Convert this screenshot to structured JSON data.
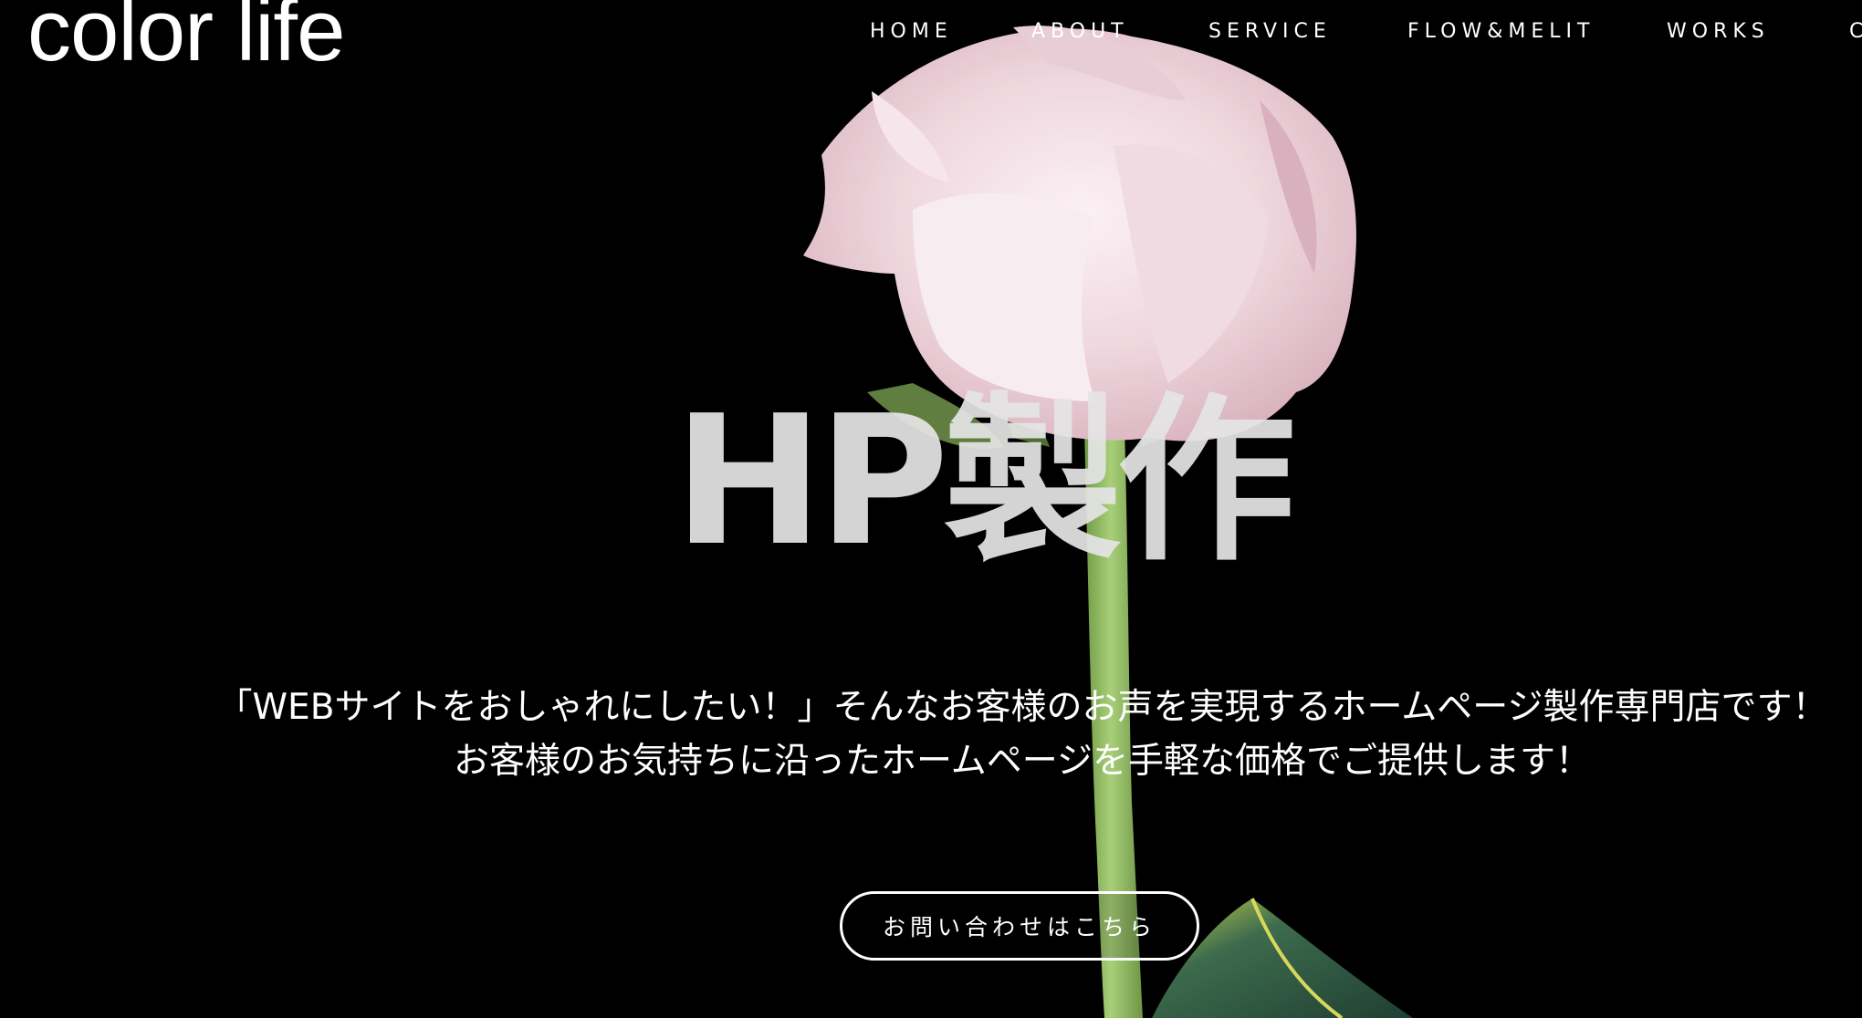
{
  "header": {
    "logo_text": "color life",
    "nav_items": [
      "HOME",
      "ABOUT",
      "SERVICE",
      "FLOW&MELIT",
      "WORKS",
      "C"
    ]
  },
  "hero": {
    "title": "HP製作",
    "copy_line1": "「WEBサイトをおしゃれにしたい！」そんなお客様のお声を実現するホームページ製作専門店です！",
    "copy_line2": "お客様のお気持ちに沿ったホームページを手軽な価格でご提供します！",
    "cta_label": "お問い合わせはこちら",
    "background_image": "pink-rose-on-black"
  },
  "colors": {
    "background": "#000000",
    "text": "#ffffff",
    "title": "#e4e4e4",
    "rose_petal": "#f1dce2",
    "stem": "#9cc36b",
    "leaf": "#2f5a43"
  }
}
